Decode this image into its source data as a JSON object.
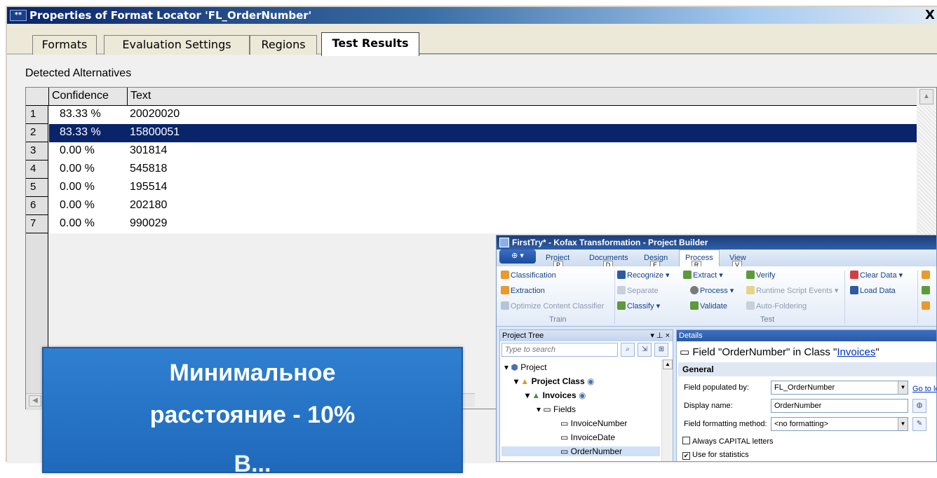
{
  "dialog": {
    "title": "Properties of Format Locator 'FL_OrderNumber'",
    "close_label": "X",
    "tabs": [
      {
        "label": "Formats"
      },
      {
        "label": "Evaluation Settings"
      },
      {
        "label": "Regions"
      },
      {
        "label": "Test Results",
        "active": true
      }
    ],
    "section_title": "Detected Alternatives",
    "columns": [
      "Confidence",
      "Text"
    ],
    "rows": [
      {
        "num": "1",
        "confidence": "83.33 %",
        "text": "20020020"
      },
      {
        "num": "2",
        "confidence": "83.33 %",
        "text": "15800051",
        "selected": true
      },
      {
        "num": "3",
        "confidence": "0.00 %",
        "text": "301814"
      },
      {
        "num": "4",
        "confidence": "0.00 %",
        "text": "545818"
      },
      {
        "num": "5",
        "confidence": "0.00 %",
        "text": "195514"
      },
      {
        "num": "6",
        "confidence": "0.00 %",
        "text": "202180"
      },
      {
        "num": "7",
        "confidence": "0.00 %",
        "text": "990029"
      }
    ]
  },
  "overlay": {
    "line1": "Минимальное",
    "line2": "расстояние - 10%",
    "line3": "В..."
  },
  "kofax": {
    "title": "FirstTry* - Kofax Transformation - Project Builder",
    "ribbon_tabs": [
      {
        "label": "Project",
        "key": "P"
      },
      {
        "label": "Documents",
        "key": "D"
      },
      {
        "label": "Design",
        "key": "E"
      },
      {
        "label": "Process",
        "key": "R",
        "active": true
      },
      {
        "label": "View",
        "key": "V"
      }
    ],
    "train": {
      "classification": "Classification",
      "extraction": "Extraction",
      "optimize": "Optimize Content Classifier",
      "group": "Train"
    },
    "test": {
      "recognize": "Recognize",
      "separate": "Separate",
      "classify": "Classify",
      "extract": "Extract",
      "process": "Process",
      "validate": "Validate",
      "verify": "Verify",
      "runtime": "Runtime Script Events",
      "autofoldering": "Auto-Foldering",
      "group": "Test"
    },
    "data": {
      "clear": "Clear Data",
      "load": "Load Data"
    },
    "project_tree": {
      "header": "Project Tree",
      "controls": "▾ ⊥ ×",
      "search_placeholder": "Type to search",
      "items": {
        "project": "Project",
        "project_class": "Project Class",
        "invoices": "Invoices",
        "fields": "Fields",
        "invoice_number": "InvoiceNumber",
        "invoice_date": "InvoiceDate",
        "order_number": "OrderNumber"
      }
    },
    "details": {
      "header": "Details",
      "title_prefix": "Field \"OrderNumber\" in Class \"",
      "title_link": "Invoices",
      "title_suffix": "\"",
      "general": "General",
      "populated_label": "Field populated by:",
      "populated_value": "FL_OrderNumber",
      "goto_link": "Go to lo",
      "display_label": "Display name:",
      "display_value": "OrderNumber",
      "format_label": "Field formatting method:",
      "format_value": "<no formatting>",
      "always_caps": "Always CAPITAL letters",
      "use_stats": "Use for statistics"
    }
  }
}
